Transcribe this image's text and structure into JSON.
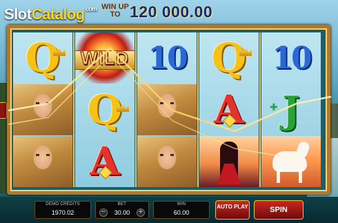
{
  "logo": {
    "text_a": "Slot",
    "text_b": "Catalog",
    "suffix": "com"
  },
  "header": {
    "win_up_to_label": "WIN UP TO",
    "jackpot_value": "120 000.00"
  },
  "reels": [
    [
      "Q",
      "woman",
      "woman"
    ],
    [
      "WILD",
      "Q",
      "A"
    ],
    [
      "10",
      "woman",
      "woman"
    ],
    [
      "Q",
      "A",
      "couple"
    ],
    [
      "10",
      "J",
      "unicorn"
    ]
  ],
  "wild_label": "WILD",
  "symbols": {
    "q": "Q",
    "ten": "10",
    "ace": "A",
    "jack": "J"
  },
  "controls": {
    "demo_credits_label": "DEMO CREDITS",
    "demo_credits_value": "1970.02",
    "bet_label": "BET",
    "bet_value": "30.00",
    "bet_decrease": "−",
    "bet_increase": "+",
    "win_label": "WIN",
    "win_value": "60.00",
    "autoplay_label": "AUTO PLAY",
    "spin_label": "SPIN"
  },
  "colors": {
    "frame_gold": "#b07a2c",
    "button_red": "#c8281f",
    "jackpot_navy": "#1c2a6a"
  }
}
